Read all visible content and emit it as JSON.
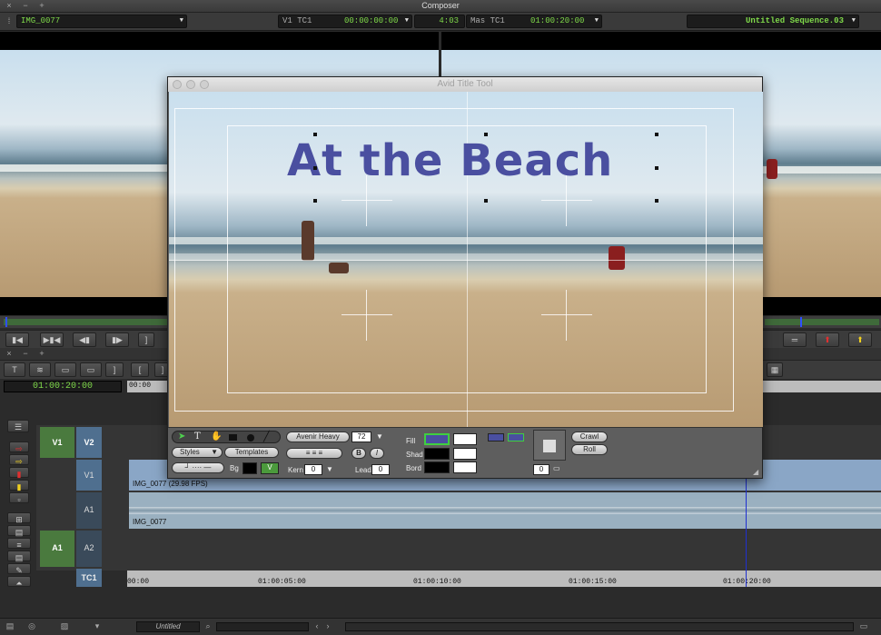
{
  "window": {
    "title": "Composer"
  },
  "header": {
    "source_clip": "IMG_0077",
    "tc_track": "V1",
    "tc_label": "TC1",
    "tc_value": "00:00:00:00",
    "duration": "4:03",
    "mas_label": "Mas",
    "mas_tc_label": "TC1",
    "mas_value": "01:00:20:00",
    "sequence": "Untitled Sequence.03"
  },
  "title_tool": {
    "window_title": "Avid Title Tool",
    "title_text": "At the Beach",
    "font": "Avenir Heavy",
    "size": "72",
    "styles_label": "Styles",
    "templates_label": "Templates",
    "bg_label": "Bg",
    "kern_label": "Kern",
    "kern_value": "0",
    "lead_label": "Lead",
    "lead_value": "0",
    "fill_label": "Fill",
    "shad_label": "Shad",
    "bord_label": "Bord",
    "crawl_label": "Crawl",
    "roll_label": "Roll",
    "shadow_value": "0",
    "bold_label": "B",
    "italic_label": "I",
    "fill_color": "#4a4fa0"
  },
  "timeline": {
    "timecode": "01:00:20:00",
    "ruler_start": "00:00",
    "tracks": {
      "v1_src": "V1",
      "v2": "V2",
      "v1": "V1",
      "a1": "A1",
      "a1_src": "A1",
      "a2": "A2",
      "tc1": "TC1"
    },
    "clip_v1": "IMG_0077 (29.98 FPS)",
    "clip_a1": "IMG_0077",
    "ruler_marks": [
      "00:00",
      "01:00:05:00",
      "01:00:10:00",
      "01:00:15:00",
      "01:00:20:00"
    ],
    "playhead_fraction": 0.82
  },
  "bottom": {
    "bin_label": "Untitled"
  }
}
